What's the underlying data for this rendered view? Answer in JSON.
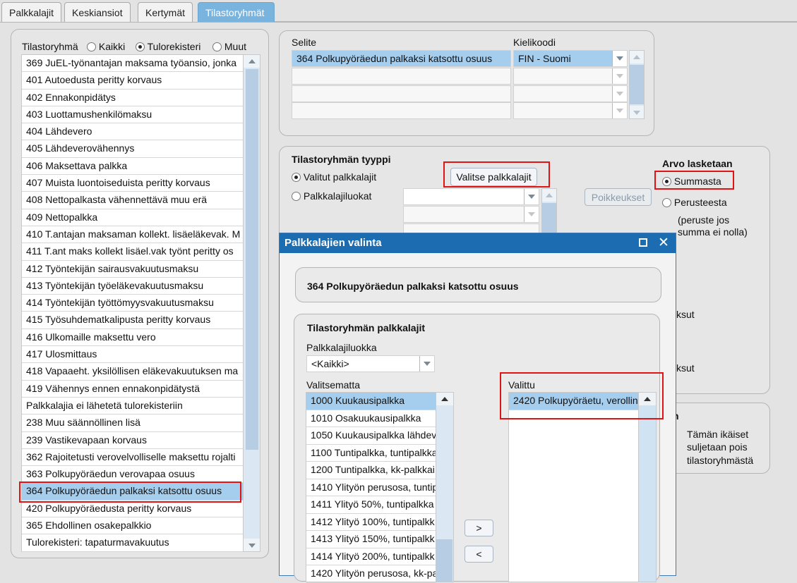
{
  "tabs": [
    "Palkkalajit",
    "Keskiansiot",
    "Kertymät",
    "Tilastoryhmät"
  ],
  "left_panel": {
    "label": "Tilastoryhmä",
    "radio_all": "Kaikki",
    "radio_income_register": "Tulorekisteri",
    "radio_other": "Muut",
    "selected_radio": "Tulorekisteri",
    "items": [
      "369 JuEL-työnantajan maksama työansio, jonka",
      "401 Autoedusta peritty korvaus",
      "402 Ennakonpidätys",
      "403 Luottamushenkilömaksu",
      "404 Lähdevero",
      "405 Lähdeverovähennys",
      "406 Maksettava palkka",
      "407 Muista luontoiseduista peritty korvaus",
      "408 Nettopalkasta vähennettävä muu erä",
      "409 Nettopalkka",
      "410 T.antajan maksaman kollekt. lisäeläkevak. M",
      "411 T.ant maks kollekt lisäel.vak työnt peritty os",
      "412 Työntekijän sairausvakuutusmaksu",
      "413 Työntekijän työeläkevakuutusmaksu",
      "414 Työntekijän työttömyysvakuutusmaksu",
      "415 Työsuhdematkalipusta peritty korvaus",
      "416 Ulkomaille maksettu vero",
      "417 Ulosmittaus",
      "418 Vapaaeht. yksilöllisen eläkevakuutuksen ma",
      "419 Vähennys ennen ennakonpidätystä",
      "Palkkalajia ei lähetetä tulorekisteriin",
      "238 Muu säännöllinen lisä",
      "239 Vastikevapaan korvaus",
      "362 Rajoitetusti verovelvolliselle maksettu rojalti",
      "363 Polkupyöräedun verovapaa osuus",
      "364 Polkupyöräedun palkaksi katsottu osuus",
      "420 Polkupyöräedusta peritty korvaus",
      "365 Ehdollinen osakepalkkio",
      "Tulorekisteri: tapaturmavakuutus"
    ],
    "selected_item": "364 Polkupyöräedun palkaksi katsottu osuus"
  },
  "description_grid": {
    "header_description": "Selite",
    "header_language": "Kielikoodi",
    "row_description": "364 Polkupyöräedun palkaksi katsottu osuus",
    "row_language": "FIN - Suomi"
  },
  "type_panel": {
    "title": "Tilastoryhmän tyyppi",
    "radio_selected_paytypes": "Valitut palkkalajit",
    "radio_paytype_classes": "Palkkalajiluokat",
    "select_button": "Valitse palkkalajit",
    "exceptions_button": "Poikkeukset",
    "value_title": "Arvo lasketaan",
    "radio_sum": "Summasta",
    "radio_base": "Perusteesta",
    "base_note_1": "(peruste jos",
    "base_note_2": "summa ei nolla)",
    "partial_1": "ksut",
    "partial_2": "ksut",
    "partial_3": "n",
    "info_text_1": "Tämän ikäiset",
    "info_text_2": "suljetaan pois",
    "info_text_3": "tilastoryhmästä"
  },
  "dialog": {
    "title": "Palkkalajien valinta",
    "heading": "364 Polkupyöräedun palkaksi katsottu osuus",
    "group_title": "Tilastoryhmän palkkalajit",
    "class_label": "Palkkalajiluokka",
    "class_value": "<Kaikki>",
    "unselected_label": "Valitsematta",
    "selected_label": "Valittu",
    "unselected_items": [
      "1000 Kuukausipalkka",
      "1010 Osakuukausipalkka",
      "1050 Kuukausipalkka lähdev",
      "1100 Tuntipalkka, tuntipalkka",
      "1200 Tuntipalkka, kk-palkkai",
      "1410 Ylityön perusosa, tuntip",
      "1411 Ylityö 50%, tuntipalkka",
      "1412 Ylityö 100%, tuntipalkk",
      "1413 Ylityö 150%, tuntipalkk",
      "1414 Ylityö 200%, tuntipalkk",
      "1420 Ylityön perusosa, kk-pal"
    ],
    "selected_items": [
      "2420 Polkupyöräetu, verollin"
    ],
    "add_button": ">",
    "remove_button": "<"
  }
}
